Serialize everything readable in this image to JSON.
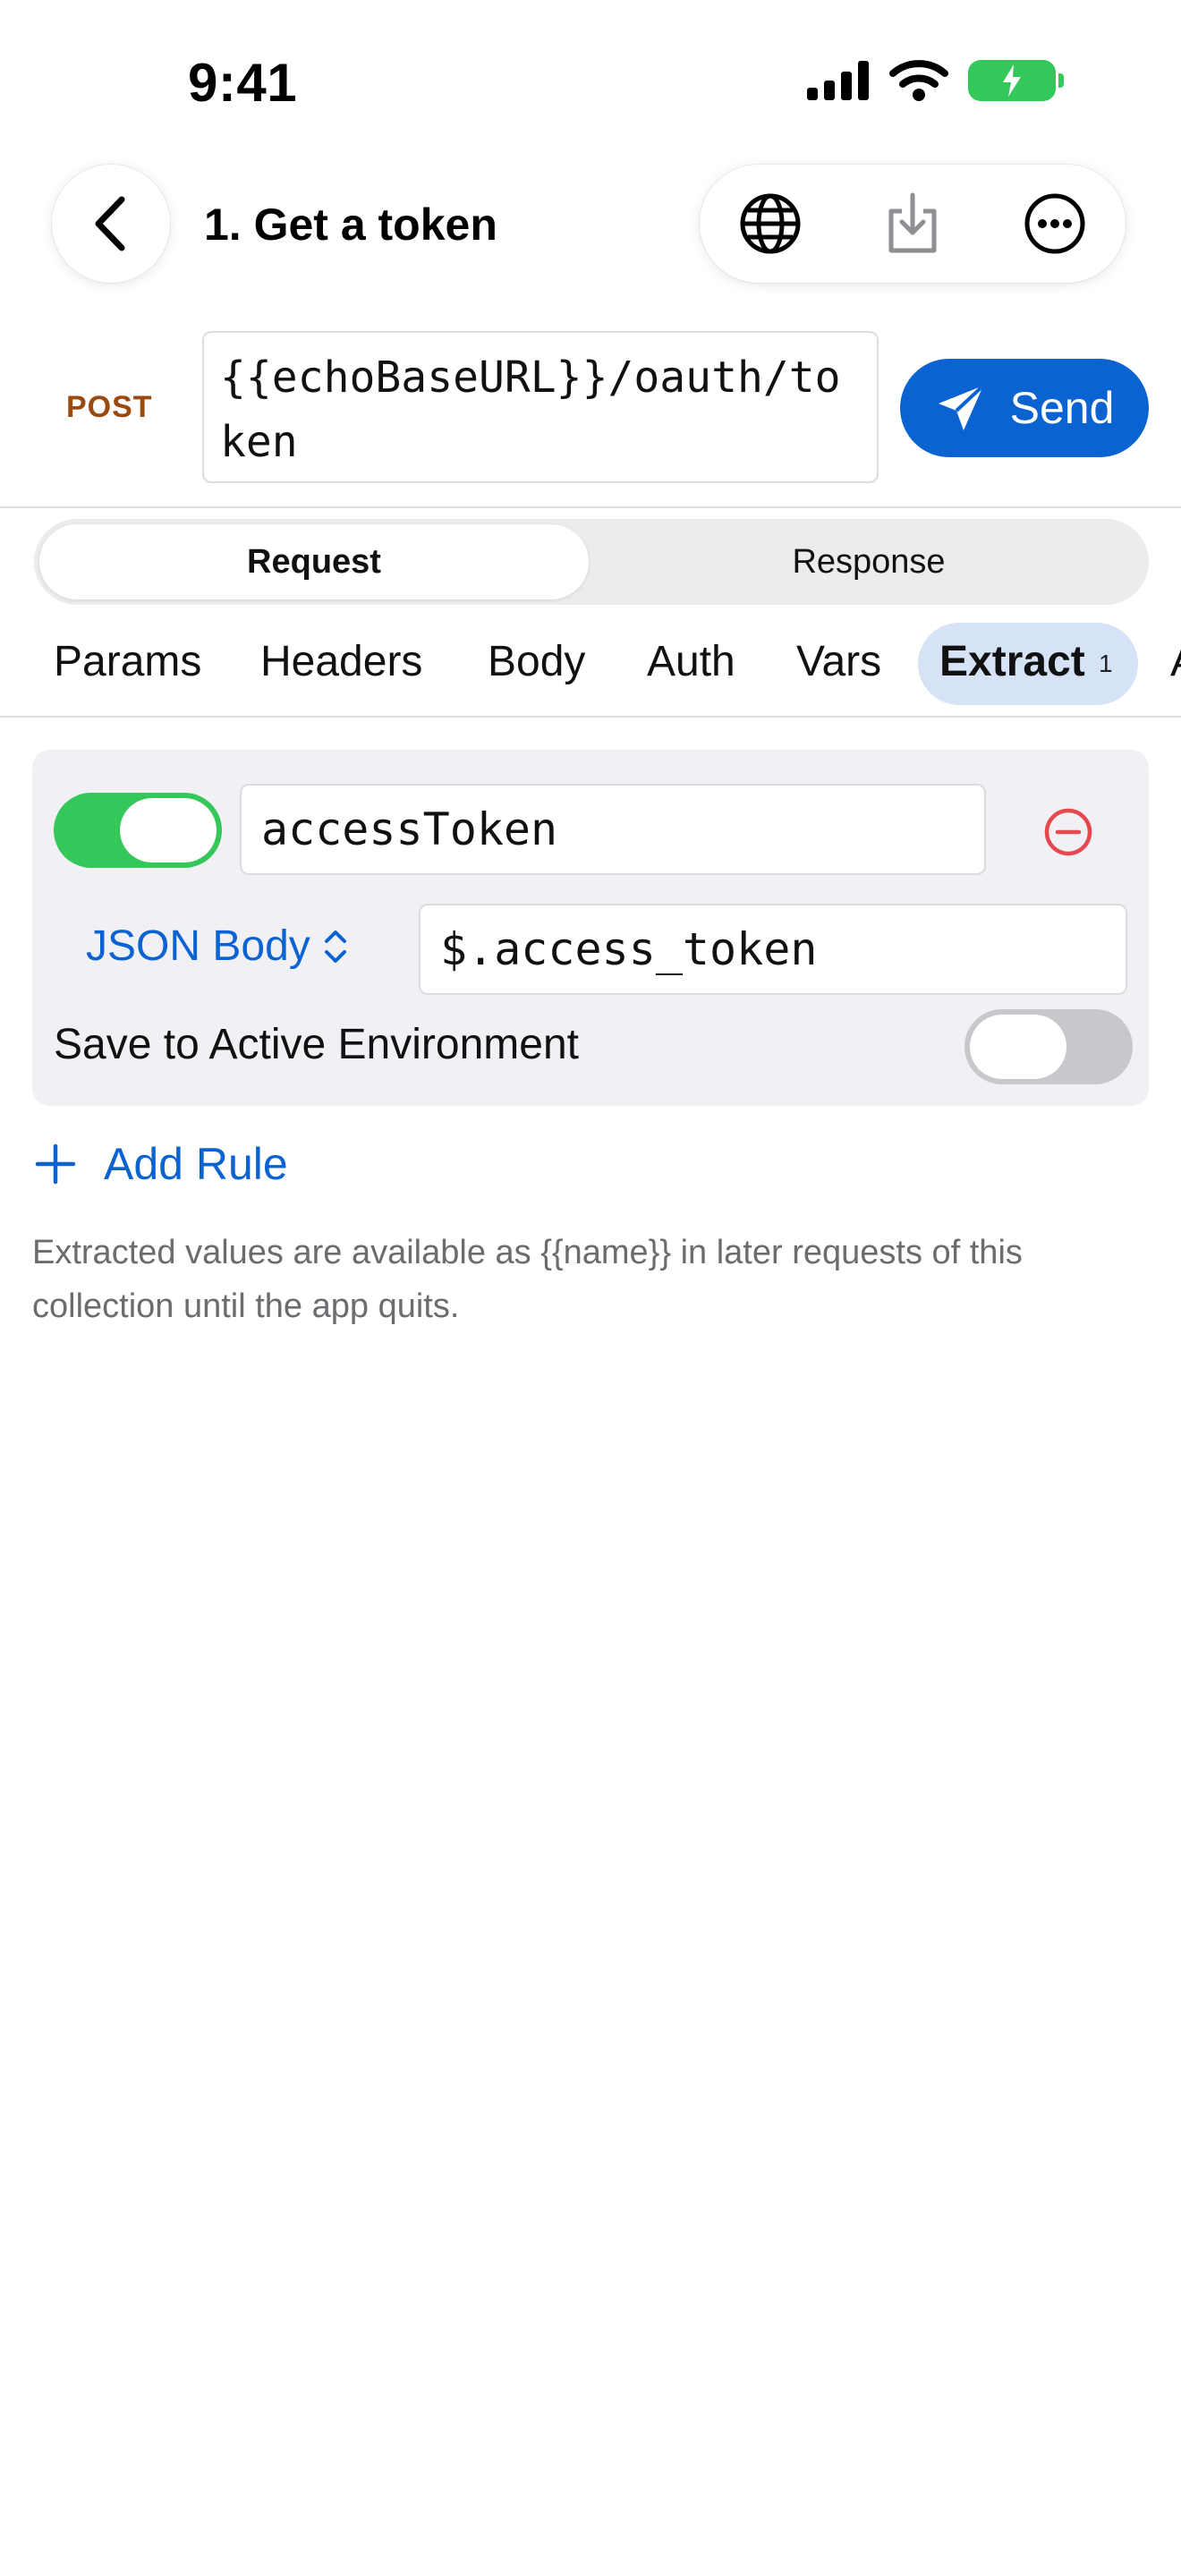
{
  "status_bar": {
    "time": "9:41"
  },
  "nav": {
    "title": "1. Get a token"
  },
  "request": {
    "method": "POST",
    "url": "{{echoBaseURL}}/oauth/token",
    "send_label": "Send"
  },
  "segments": {
    "request": "Request",
    "response": "Response"
  },
  "tabs": {
    "params": "Params",
    "headers": "Headers",
    "body": "Body",
    "auth": "Auth",
    "vars": "Vars",
    "extract": "Extract",
    "extract_badge": "1"
  },
  "rule": {
    "enabled": true,
    "name": "accessToken",
    "source": "JSON Body",
    "path": "$.access_token",
    "save_label": "Save to Active Environment",
    "save_enabled": false
  },
  "add_rule_label": "Add Rule",
  "footnote": "Extracted values are available as {{name}} in later requests of this collection until the app quits.",
  "colors": {
    "accent": "#0a63d0",
    "toggle_on": "#34c759",
    "destructive": "#e5484d",
    "method": "#9a4a10"
  }
}
